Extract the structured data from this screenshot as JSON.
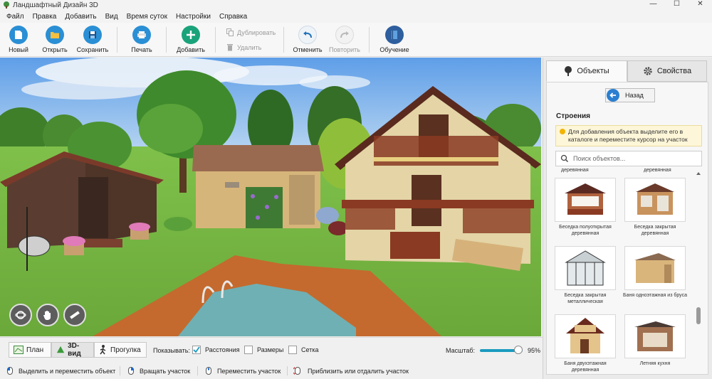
{
  "window": {
    "title": "Ландшафтный Дизайн 3D",
    "minimize": "—",
    "maximize": "☐",
    "close": "✕"
  },
  "menu": [
    "Файл",
    "Правка",
    "Добавить",
    "Вид",
    "Время суток",
    "Настройки",
    "Справка"
  ],
  "toolbar": {
    "new_label": "Новый",
    "open_label": "Открыть",
    "save_label": "Сохранить",
    "print_label": "Печать",
    "add_label": "Добавить",
    "duplicate_label": "Дублировать",
    "delete_label": "Удалить",
    "undo_label": "Отменить",
    "redo_label": "Повторить",
    "learn_label": "Обучение"
  },
  "viewbar": {
    "plan_label": "План",
    "view3d_label": "3D-вид",
    "walk_label": "Прогулка",
    "show_label": "Показывать:",
    "options": [
      {
        "label": "Расстояния",
        "checked": true
      },
      {
        "label": "Размеры",
        "checked": false
      },
      {
        "label": "Сетка",
        "checked": false
      }
    ],
    "zoom_label": "Масштаб:",
    "zoom_value": "95%",
    "zoom_level": 0.8
  },
  "status": [
    "Выделить и переместить объект",
    "Вращать участок",
    "Переместить участок",
    "Приблизить или отдалить участок"
  ],
  "panel": {
    "tab_objects": "Объекты",
    "tab_properties": "Свойства",
    "back_label": "Назад",
    "section_title": "Строения",
    "hint": "Для добавления объекта выделите его в каталоге и переместите курсор на участок",
    "search_placeholder": "Поиск объектов...",
    "top_labels": [
      "деревянная",
      "деревянная"
    ],
    "items": [
      "Беседка полуоткрытая деревянная",
      "Беседка закрытая деревянная",
      "Беседка закрытая металлическая",
      "Баня одноэтажная из бруса",
      "Баня двухэтажная деревянная",
      "Летняя кухня"
    ]
  },
  "colors": {
    "accent": "#1a9abf",
    "add_button": "#1aa37a",
    "toolbar_icon": "#2a8fd4",
    "learn_icon": "#2e5f9e",
    "hint_bg": "#fdf6d8",
    "back_arrow": "#2a7fd0"
  }
}
